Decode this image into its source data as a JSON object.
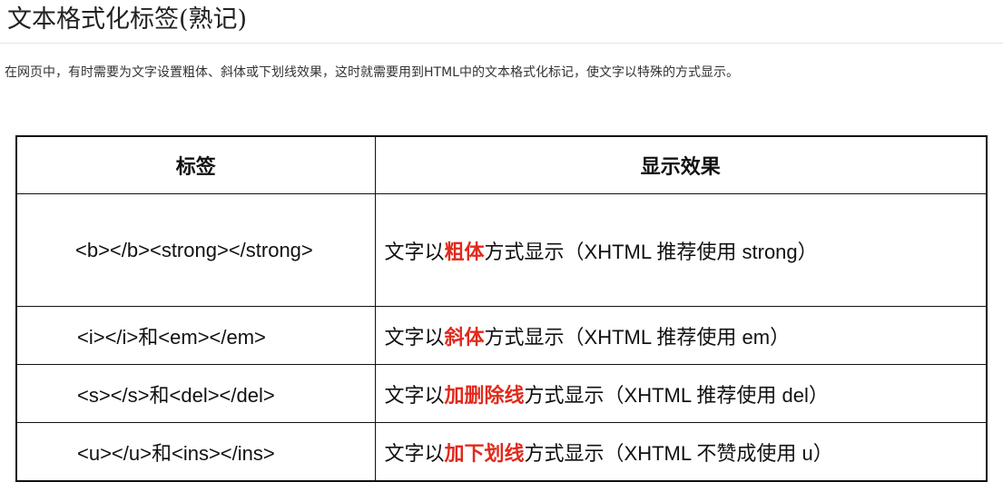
{
  "page": {
    "title": "文本格式化标签(熟记)",
    "intro": "在网页中，有时需要为文字设置粗体、斜体或下划线效果，这时就需要用到HTML中的文本格式化标记，使文字以特殊的方式显示。"
  },
  "table": {
    "headers": [
      "标签",
      "显示效果"
    ],
    "rows": [
      {
        "tag": "<b></b><strong></strong>",
        "effect_prefix": "文字以",
        "effect_highlight": "粗体",
        "effect_suffix": "方式显示（XHTML 推荐使用 strong）"
      },
      {
        "tag": "<i></i>和<em></em>",
        "effect_prefix": "文字以",
        "effect_highlight": "斜体",
        "effect_suffix": "方式显示（XHTML 推荐使用 em）"
      },
      {
        "tag": "<s></s>和<del></del>",
        "effect_prefix": "文字以",
        "effect_highlight": "加删除线",
        "effect_suffix": "方式显示（XHTML 推荐使用 del）"
      },
      {
        "tag": "<u></u>和<ins></ins>",
        "effect_prefix": "文字以",
        "effect_highlight": "加下划线",
        "effect_suffix": "方式显示（XHTML 不赞成使用 u）"
      }
    ],
    "highlight_color": "#e02a1c",
    "border_color": "#111111"
  }
}
